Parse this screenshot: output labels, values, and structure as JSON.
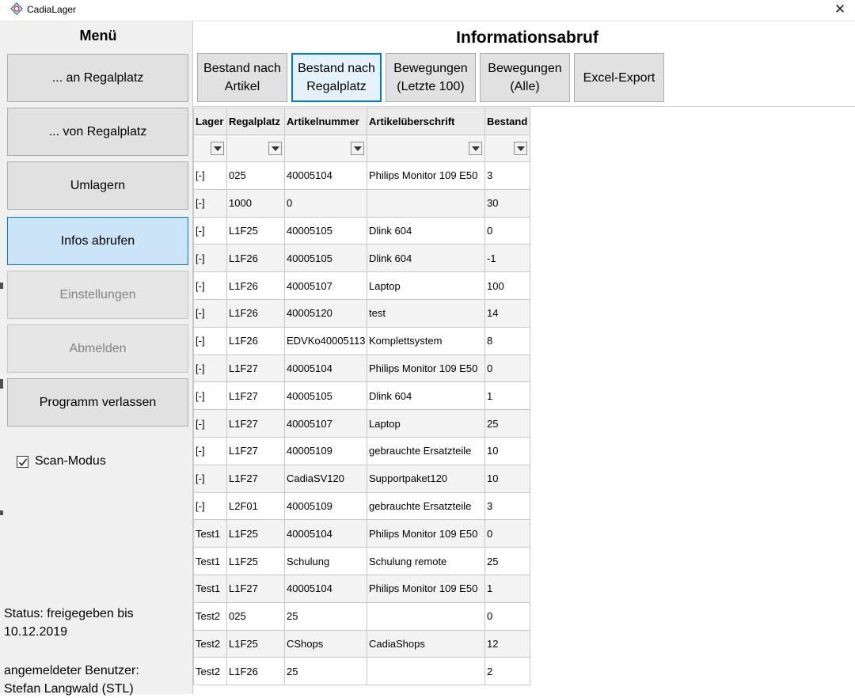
{
  "window": {
    "title": "CadiaLager"
  },
  "sidebar": {
    "title": "Menü",
    "buttons": [
      {
        "label": "... an Regalplatz",
        "state": "normal"
      },
      {
        "label": "... von Regalplatz",
        "state": "normal"
      },
      {
        "label": "Umlagern",
        "state": "normal"
      },
      {
        "label": "Infos abrufen",
        "state": "active"
      },
      {
        "label": "Einstellungen",
        "state": "disabled"
      },
      {
        "label": "Abmelden",
        "state": "disabled"
      },
      {
        "label": "Programm verlassen",
        "state": "normal"
      }
    ],
    "scan_mode": {
      "label": "Scan-Modus",
      "checked": true
    },
    "status_text": "Status: freigegeben bis 10.12.2019",
    "user_label": "angemeldeter Benutzer:",
    "user_name": "Stefan Langwald (STL)"
  },
  "main": {
    "title": "Informationsabruf",
    "toolbar": [
      {
        "label": "Bestand nach Artikel"
      },
      {
        "label": "Bestand nach Regalplatz"
      },
      {
        "label": "Bewegungen (Letzte 100)"
      },
      {
        "label": "Bewegungen (Alle)"
      },
      {
        "label": "Excel-Export"
      }
    ]
  },
  "grid": {
    "columns": [
      "Lager",
      "Regalplatz",
      "Artikelnummer",
      "Artikelüberschrift",
      "Bestand"
    ],
    "rows": [
      [
        "[-]",
        "025",
        "40005104",
        "Philips Monitor 109 E50",
        "3"
      ],
      [
        "[-]",
        "1000",
        "0",
        "",
        "30"
      ],
      [
        "[-]",
        "L1F25",
        "40005105",
        "Dlink 604",
        "0"
      ],
      [
        "[-]",
        "L1F26",
        "40005105",
        "Dlink 604",
        "-1"
      ],
      [
        "[-]",
        "L1F26",
        "40005107",
        "Laptop",
        "100"
      ],
      [
        "[-]",
        "L1F26",
        "40005120",
        "test",
        "14"
      ],
      [
        "[-]",
        "L1F26",
        "EDVKo40005113",
        "Komplettsystem",
        "8"
      ],
      [
        "[-]",
        "L1F27",
        "40005104",
        "Philips Monitor 109 E50",
        "0"
      ],
      [
        "[-]",
        "L1F27",
        "40005105",
        "Dlink 604",
        "1"
      ],
      [
        "[-]",
        "L1F27",
        "40005107",
        "Laptop",
        "25"
      ],
      [
        "[-]",
        "L1F27",
        "40005109",
        "gebrauchte Ersatzteile",
        "10"
      ],
      [
        "[-]",
        "L1F27",
        "CadiaSV120",
        "Supportpaket120",
        "10"
      ],
      [
        "[-]",
        "L2F01",
        "40005109",
        "gebrauchte Ersatzteile",
        "3"
      ],
      [
        "Test1",
        "L1F25",
        "40005104",
        "Philips Monitor 109 E50",
        "0"
      ],
      [
        "Test1",
        "L1F25",
        "Schulung",
        "Schulung remote",
        "25"
      ],
      [
        "Test1",
        "L1F27",
        "40005104",
        "Philips Monitor 109 E50",
        "1"
      ],
      [
        "Test2",
        "025",
        "25",
        "",
        "0"
      ],
      [
        "Test2",
        "L1F25",
        "CShops",
        "CadiaShops",
        "12"
      ],
      [
        "Test2",
        "L1F26",
        "25",
        "",
        "2"
      ]
    ]
  }
}
